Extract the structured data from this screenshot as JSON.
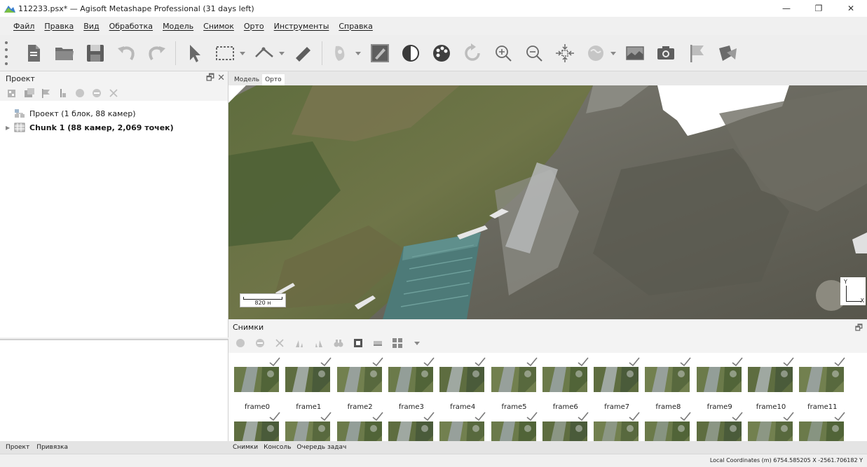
{
  "window": {
    "title": "112233.psx* — Agisoft Metashape Professional (31 days left)",
    "controls": {
      "minimize": "—",
      "maximize": "❐",
      "close": "✕"
    }
  },
  "menu": [
    "Файл",
    "Правка",
    "Вид",
    "Обработка",
    "Модель",
    "Снимок",
    "Орто",
    "Инструменты",
    "Справка"
  ],
  "toolbar": {
    "icons": [
      "new-document-icon",
      "open-folder-icon",
      "save-icon",
      "undo-icon",
      "redo-icon",
      "navigation-pointer-icon",
      "rectangle-selection-icon",
      "ruler-icon",
      "shape-polyline-icon",
      "ruler-tape-icon",
      "brush-icon",
      "ortho-edit-icon",
      "contrast-icon",
      "color-palette-icon",
      "reset-view-icon",
      "zoom-in-icon",
      "zoom-out-icon",
      "fit-view-icon",
      "sphere-icon",
      "ortho-view-icon",
      "camera-icon",
      "marker-flag-icon",
      "shapes-icon"
    ]
  },
  "project_panel": {
    "title": "Проект",
    "undock": "🗗",
    "close": "✕",
    "tool_icons": [
      "add-chunk-icon",
      "add-photos-icon",
      "add-marker-icon",
      "add-scalebar-icon",
      "enable-icon",
      "disable-icon",
      "remove-icon"
    ],
    "tree": [
      {
        "label": "Проект (1 блок, 88 камер)",
        "bold": false,
        "expander": ""
      },
      {
        "label": "Chunk 1 (88 камер, 2,069 точек)",
        "bold": true,
        "expander": "▶"
      }
    ],
    "bottom_tabs": [
      "Проект",
      "Привязка"
    ]
  },
  "view": {
    "tabs": [
      "Модель",
      "Орто"
    ],
    "active_tab": "Орто",
    "scale_label": "820 н",
    "axis": {
      "y": "Y",
      "x": "X"
    }
  },
  "photos_panel": {
    "title": "Снимки",
    "undock": "🗗",
    "tool_icons": [
      "enable-photo-icon",
      "disable-photo-icon",
      "remove-photo-icon",
      "rotate-left-icon",
      "rotate-right-icon",
      "filter-icon",
      "camera-view-icon",
      "detail-view-icon",
      "grid-view-icon"
    ],
    "frames": [
      "frame0",
      "frame1",
      "frame2",
      "frame3",
      "frame4",
      "frame5",
      "frame6",
      "frame7",
      "frame8",
      "frame9",
      "frame10",
      "frame11"
    ],
    "second_row_count": 12,
    "bottom_tabs": [
      "Снимки",
      "Консоль",
      "Очередь задач"
    ]
  },
  "status": {
    "coordinates": "Local Coordinates (m)  6754.585205 X  -2561.706182 Y"
  },
  "colors": {
    "background": "#f0f0f0",
    "panel": "#ffffff",
    "roof": "#4d7a78",
    "grass": "#5a6a3a",
    "rock": "#6f6b5c"
  }
}
